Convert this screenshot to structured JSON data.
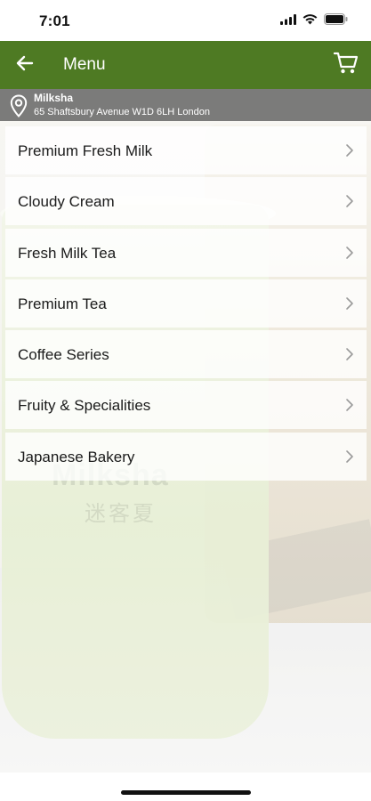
{
  "status_bar": {
    "time": "7:01",
    "icons": [
      "signal-icon",
      "wifi-icon",
      "battery-icon"
    ]
  },
  "nav": {
    "title": "Menu",
    "back_icon": "back-arrow-icon",
    "cart_icon": "cart-icon",
    "color": "#4e7a23"
  },
  "location": {
    "name": "Milksha",
    "address": "65 Shaftsbury Avenue W1D 6LH London",
    "icon": "location-pin-icon"
  },
  "background_photo": {
    "logo_text": "Milksha",
    "logo_text_cn": "迷客夏"
  },
  "menu": {
    "items": [
      {
        "label": "Premium Fresh Milk"
      },
      {
        "label": "Cloudy Cream"
      },
      {
        "label": "Fresh Milk Tea"
      },
      {
        "label": "Premium Tea"
      },
      {
        "label": "Coffee Series"
      },
      {
        "label": "Fruity & Specialities"
      },
      {
        "label": "Japanese Bakery"
      }
    ]
  }
}
